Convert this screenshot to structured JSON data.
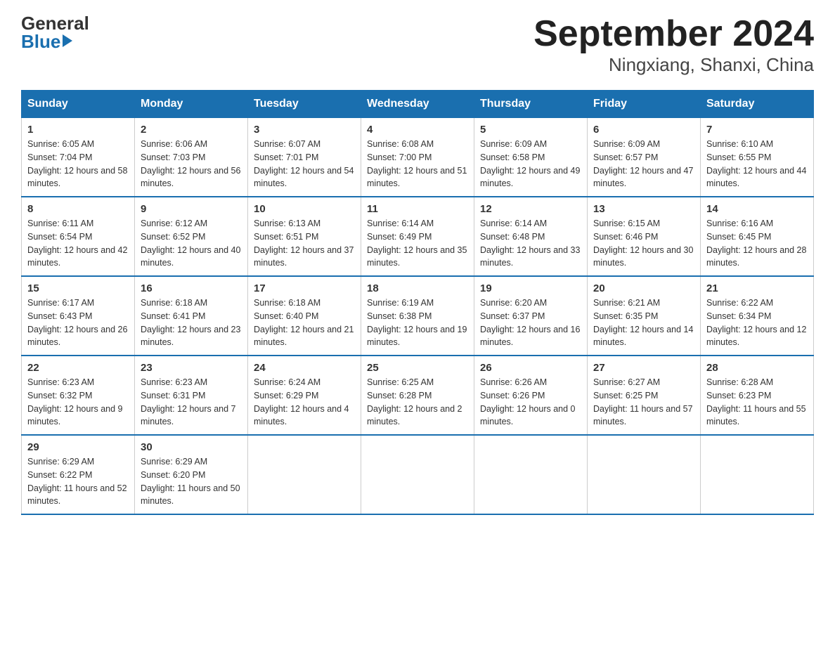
{
  "logo": {
    "general": "General",
    "blue": "Blue"
  },
  "title": {
    "month_year": "September 2024",
    "location": "Ningxiang, Shanxi, China"
  },
  "headers": [
    "Sunday",
    "Monday",
    "Tuesday",
    "Wednesday",
    "Thursday",
    "Friday",
    "Saturday"
  ],
  "weeks": [
    [
      {
        "day": "1",
        "sunrise": "Sunrise: 6:05 AM",
        "sunset": "Sunset: 7:04 PM",
        "daylight": "Daylight: 12 hours and 58 minutes."
      },
      {
        "day": "2",
        "sunrise": "Sunrise: 6:06 AM",
        "sunset": "Sunset: 7:03 PM",
        "daylight": "Daylight: 12 hours and 56 minutes."
      },
      {
        "day": "3",
        "sunrise": "Sunrise: 6:07 AM",
        "sunset": "Sunset: 7:01 PM",
        "daylight": "Daylight: 12 hours and 54 minutes."
      },
      {
        "day": "4",
        "sunrise": "Sunrise: 6:08 AM",
        "sunset": "Sunset: 7:00 PM",
        "daylight": "Daylight: 12 hours and 51 minutes."
      },
      {
        "day": "5",
        "sunrise": "Sunrise: 6:09 AM",
        "sunset": "Sunset: 6:58 PM",
        "daylight": "Daylight: 12 hours and 49 minutes."
      },
      {
        "day": "6",
        "sunrise": "Sunrise: 6:09 AM",
        "sunset": "Sunset: 6:57 PM",
        "daylight": "Daylight: 12 hours and 47 minutes."
      },
      {
        "day": "7",
        "sunrise": "Sunrise: 6:10 AM",
        "sunset": "Sunset: 6:55 PM",
        "daylight": "Daylight: 12 hours and 44 minutes."
      }
    ],
    [
      {
        "day": "8",
        "sunrise": "Sunrise: 6:11 AM",
        "sunset": "Sunset: 6:54 PM",
        "daylight": "Daylight: 12 hours and 42 minutes."
      },
      {
        "day": "9",
        "sunrise": "Sunrise: 6:12 AM",
        "sunset": "Sunset: 6:52 PM",
        "daylight": "Daylight: 12 hours and 40 minutes."
      },
      {
        "day": "10",
        "sunrise": "Sunrise: 6:13 AM",
        "sunset": "Sunset: 6:51 PM",
        "daylight": "Daylight: 12 hours and 37 minutes."
      },
      {
        "day": "11",
        "sunrise": "Sunrise: 6:14 AM",
        "sunset": "Sunset: 6:49 PM",
        "daylight": "Daylight: 12 hours and 35 minutes."
      },
      {
        "day": "12",
        "sunrise": "Sunrise: 6:14 AM",
        "sunset": "Sunset: 6:48 PM",
        "daylight": "Daylight: 12 hours and 33 minutes."
      },
      {
        "day": "13",
        "sunrise": "Sunrise: 6:15 AM",
        "sunset": "Sunset: 6:46 PM",
        "daylight": "Daylight: 12 hours and 30 minutes."
      },
      {
        "day": "14",
        "sunrise": "Sunrise: 6:16 AM",
        "sunset": "Sunset: 6:45 PM",
        "daylight": "Daylight: 12 hours and 28 minutes."
      }
    ],
    [
      {
        "day": "15",
        "sunrise": "Sunrise: 6:17 AM",
        "sunset": "Sunset: 6:43 PM",
        "daylight": "Daylight: 12 hours and 26 minutes."
      },
      {
        "day": "16",
        "sunrise": "Sunrise: 6:18 AM",
        "sunset": "Sunset: 6:41 PM",
        "daylight": "Daylight: 12 hours and 23 minutes."
      },
      {
        "day": "17",
        "sunrise": "Sunrise: 6:18 AM",
        "sunset": "Sunset: 6:40 PM",
        "daylight": "Daylight: 12 hours and 21 minutes."
      },
      {
        "day": "18",
        "sunrise": "Sunrise: 6:19 AM",
        "sunset": "Sunset: 6:38 PM",
        "daylight": "Daylight: 12 hours and 19 minutes."
      },
      {
        "day": "19",
        "sunrise": "Sunrise: 6:20 AM",
        "sunset": "Sunset: 6:37 PM",
        "daylight": "Daylight: 12 hours and 16 minutes."
      },
      {
        "day": "20",
        "sunrise": "Sunrise: 6:21 AM",
        "sunset": "Sunset: 6:35 PM",
        "daylight": "Daylight: 12 hours and 14 minutes."
      },
      {
        "day": "21",
        "sunrise": "Sunrise: 6:22 AM",
        "sunset": "Sunset: 6:34 PM",
        "daylight": "Daylight: 12 hours and 12 minutes."
      }
    ],
    [
      {
        "day": "22",
        "sunrise": "Sunrise: 6:23 AM",
        "sunset": "Sunset: 6:32 PM",
        "daylight": "Daylight: 12 hours and 9 minutes."
      },
      {
        "day": "23",
        "sunrise": "Sunrise: 6:23 AM",
        "sunset": "Sunset: 6:31 PM",
        "daylight": "Daylight: 12 hours and 7 minutes."
      },
      {
        "day": "24",
        "sunrise": "Sunrise: 6:24 AM",
        "sunset": "Sunset: 6:29 PM",
        "daylight": "Daylight: 12 hours and 4 minutes."
      },
      {
        "day": "25",
        "sunrise": "Sunrise: 6:25 AM",
        "sunset": "Sunset: 6:28 PM",
        "daylight": "Daylight: 12 hours and 2 minutes."
      },
      {
        "day": "26",
        "sunrise": "Sunrise: 6:26 AM",
        "sunset": "Sunset: 6:26 PM",
        "daylight": "Daylight: 12 hours and 0 minutes."
      },
      {
        "day": "27",
        "sunrise": "Sunrise: 6:27 AM",
        "sunset": "Sunset: 6:25 PM",
        "daylight": "Daylight: 11 hours and 57 minutes."
      },
      {
        "day": "28",
        "sunrise": "Sunrise: 6:28 AM",
        "sunset": "Sunset: 6:23 PM",
        "daylight": "Daylight: 11 hours and 55 minutes."
      }
    ],
    [
      {
        "day": "29",
        "sunrise": "Sunrise: 6:29 AM",
        "sunset": "Sunset: 6:22 PM",
        "daylight": "Daylight: 11 hours and 52 minutes."
      },
      {
        "day": "30",
        "sunrise": "Sunrise: 6:29 AM",
        "sunset": "Sunset: 6:20 PM",
        "daylight": "Daylight: 11 hours and 50 minutes."
      },
      {
        "day": "",
        "sunrise": "",
        "sunset": "",
        "daylight": ""
      },
      {
        "day": "",
        "sunrise": "",
        "sunset": "",
        "daylight": ""
      },
      {
        "day": "",
        "sunrise": "",
        "sunset": "",
        "daylight": ""
      },
      {
        "day": "",
        "sunrise": "",
        "sunset": "",
        "daylight": ""
      },
      {
        "day": "",
        "sunrise": "",
        "sunset": "",
        "daylight": ""
      }
    ]
  ]
}
